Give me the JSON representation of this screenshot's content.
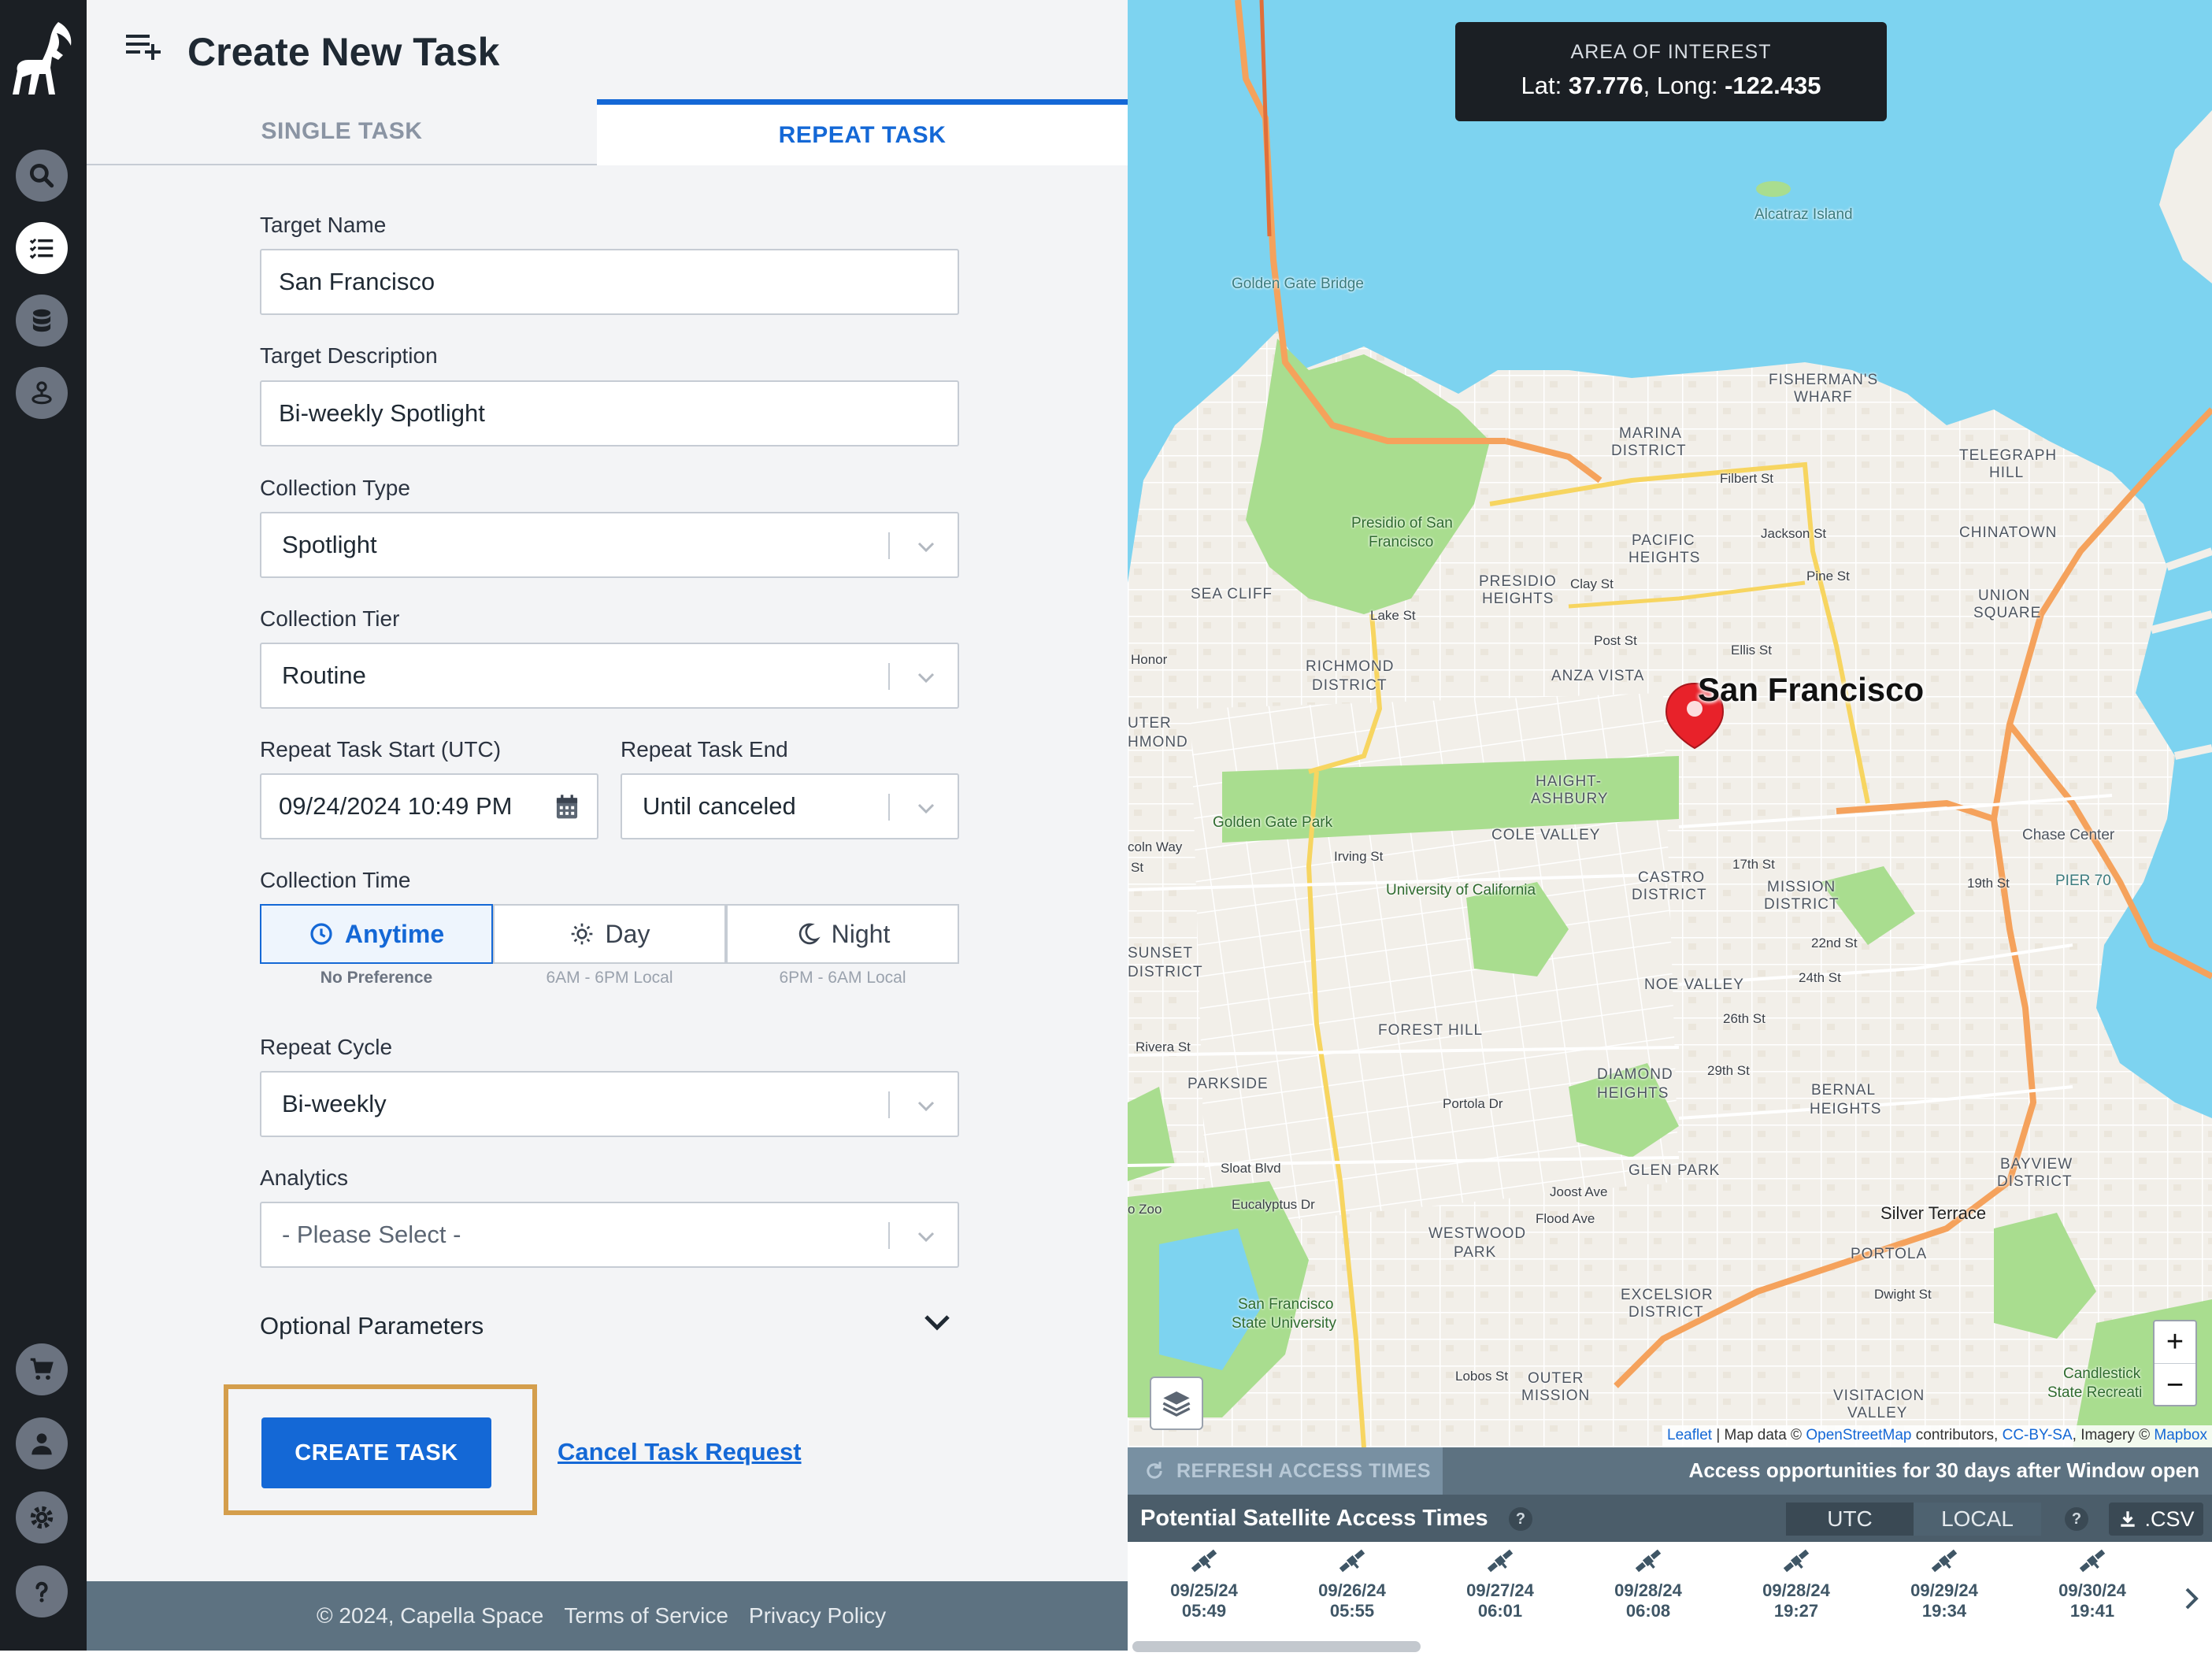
{
  "header": {
    "title": "Create New Task"
  },
  "tabs": {
    "single": "SINGLE TASK",
    "repeat": "REPEAT TASK"
  },
  "form": {
    "target_name": {
      "label": "Target Name",
      "value": "San Francisco"
    },
    "target_description": {
      "label": "Target Description",
      "value": "Bi-weekly Spotlight"
    },
    "collection_type": {
      "label": "Collection Type",
      "value": "Spotlight"
    },
    "collection_tier": {
      "label": "Collection Tier",
      "value": "Routine"
    },
    "repeat_start": {
      "label": "Repeat Task Start (UTC)",
      "value": "09/24/2024 10:49 PM"
    },
    "repeat_end": {
      "label": "Repeat Task End",
      "value": "Until canceled"
    },
    "collection_time": {
      "label": "Collection Time",
      "options": [
        {
          "label": "Anytime",
          "sub": "No Preference",
          "icon": "clock-icon"
        },
        {
          "label": "Day",
          "sub": "6AM - 6PM Local",
          "icon": "sun-icon"
        },
        {
          "label": "Night",
          "sub": "6PM - 6AM Local",
          "icon": "moon-icon"
        }
      ],
      "selected": "Anytime"
    },
    "repeat_cycle": {
      "label": "Repeat Cycle",
      "value": "Bi-weekly"
    },
    "analytics": {
      "label": "Analytics",
      "placeholder": "- Please Select -"
    },
    "optional_parameters": "Optional Parameters",
    "create_label": "CREATE TASK",
    "cancel_label": "Cancel Task Request"
  },
  "footer": {
    "copyright": "© 2024, Capella Space",
    "terms": "Terms of Service",
    "privacy": "Privacy Policy"
  },
  "map": {
    "aoi_title": "AREA OF INTEREST",
    "lat_label": "Lat:",
    "lat": "37.776",
    "long_label": "Long:",
    "long": "-122.435",
    "pin_label": "San Francisco",
    "labels": {
      "alcatraz": "Alcatraz Island",
      "golden_gate_bridge": "Golden Gate Bridge",
      "fishermans_wharf_1": "FISHERMAN'S",
      "fishermans_wharf_2": "WHARF",
      "marina_1": "MARINA",
      "marina_2": "DISTRICT",
      "telegraph_1": "TELEGRAPH",
      "telegraph_2": "HILL",
      "chinatown": "CHINATOWN",
      "presidio_park_1": "Presidio of San",
      "presidio_park_2": "Francisco",
      "pacific_heights_1": "PACIFIC",
      "pacific_heights_2": "HEIGHTS",
      "presidio_heights_1": "PRESIDIO",
      "presidio_heights_2": "HEIGHTS",
      "union_square_1": "UNION",
      "union_square_2": "SQUARE",
      "sea_cliff": "SEA CLIFF",
      "richmond_1": "RICHMOND",
      "richmond_2": "DISTRICT",
      "anza_vista": "ANZA VISTA",
      "haight_1": "HAIGHT-",
      "haight_2": "ASHBURY",
      "golden_gate_park": "Golden Gate Park",
      "cole_valley": "COLE VALLEY",
      "ucsf": "University of California",
      "castro_1": "CASTRO",
      "castro_2": "DISTRICT",
      "mission_1": "MISSION",
      "mission_2": "DISTRICT",
      "chase_center": "Chase Center",
      "pier_70": "PIER 70",
      "sunset_1": "SUNSET",
      "sunset_2": "DISTRICT",
      "noe_valley": "NOE VALLEY",
      "forest_hill": "FOREST HILL",
      "parkside": "PARKSIDE",
      "diamond_1": "DIAMOND",
      "diamond_2": "HEIGHTS",
      "bernal_1": "BERNAL",
      "bernal_2": "HEIGHTS",
      "glen_park": "GLEN PARK",
      "bayview_1": "BAYVIEW",
      "bayview_2": "DISTRICT",
      "silver_terrace": "Silver Terrace",
      "westwood_1": "WESTWOOD",
      "westwood_2": "PARK",
      "portola": "PORTOLA",
      "excelsior_1": "EXCELSIOR",
      "excelsior_2": "DISTRICT",
      "sfsu_1": "San Francisco",
      "sfsu_2": "State University",
      "outer_mission_1": "OUTER",
      "outer_mission_2": "MISSION",
      "visitacion_1": "VISITACION",
      "visitacion_2": "VALLEY",
      "candlestick_1": "Candlestick",
      "candlestick_2": "State Recreati",
      "lake_st": "Lake St",
      "clay_st": "Clay St",
      "post_st": "Post St",
      "ellis_st": "Ellis St",
      "pine_st": "Pine St",
      "jackson_st": "Jackson St",
      "filbert_st": "Filbert St",
      "irving_st": "Irving St",
      "seventeenth_st": "17th St",
      "nineteenth_st": "19th St",
      "twentysecond_st": "22nd St",
      "twentyfourth_st": "24th St",
      "twentysixth_st": "26th St",
      "twentyninth_st": "29th St",
      "rivera_st": "Rivera St",
      "sloat_blvd": "Sloat Blvd",
      "eucalyptus_dr": "Eucalyptus Dr",
      "joost_ave": "Joost Ave",
      "flood_ave": "Flood Ave",
      "dwight_st": "Dwight St",
      "lobos_st": "Lobos St",
      "portola_dr": "Portola Dr",
      "zoo": "o Zoo",
      "honor": "Honor",
      "outer_richmond_1": "UTER",
      "outer_richmond_2": "HMOND",
      "lincoln_way_1": "coln Way",
      "lincoln_way_2": "St"
    },
    "zoom_in": "+",
    "zoom_out": "−",
    "attribution": {
      "leaflet": "Leaflet",
      "map_data": " | Map data © ",
      "osm": "OpenStreetMap",
      "contributors": " contributors, ",
      "license": "CC-BY-SA",
      "imagery": ", Imagery © ",
      "mapbox": "Mapbox"
    }
  },
  "access": {
    "refresh_label": "REFRESH ACCESS TIMES",
    "note": "Access opportunities for 30 days after Window open",
    "title": "Potential Satellite Access Times",
    "help": "?",
    "tz_utc": "UTC",
    "tz_local": "LOCAL",
    "csv_label": ".CSV",
    "opportunities": [
      {
        "date": "09/25/24",
        "time": "05:49"
      },
      {
        "date": "09/26/24",
        "time": "05:55"
      },
      {
        "date": "09/27/24",
        "time": "06:01"
      },
      {
        "date": "09/28/24",
        "time": "06:08"
      },
      {
        "date": "09/28/24",
        "time": "19:27"
      },
      {
        "date": "09/29/24",
        "time": "19:34"
      },
      {
        "date": "09/30/24",
        "time": "19:41"
      }
    ]
  },
  "colors": {
    "accent": "#1468d6",
    "rail": "#1b1f24",
    "highlight_outline": "#d49e4c",
    "footer": "#5d7281",
    "water": "#7dd3f0",
    "park": "#a9dd8f",
    "land": "#f2efe9",
    "road": "#f5a25c",
    "pin": "#e8222a"
  }
}
